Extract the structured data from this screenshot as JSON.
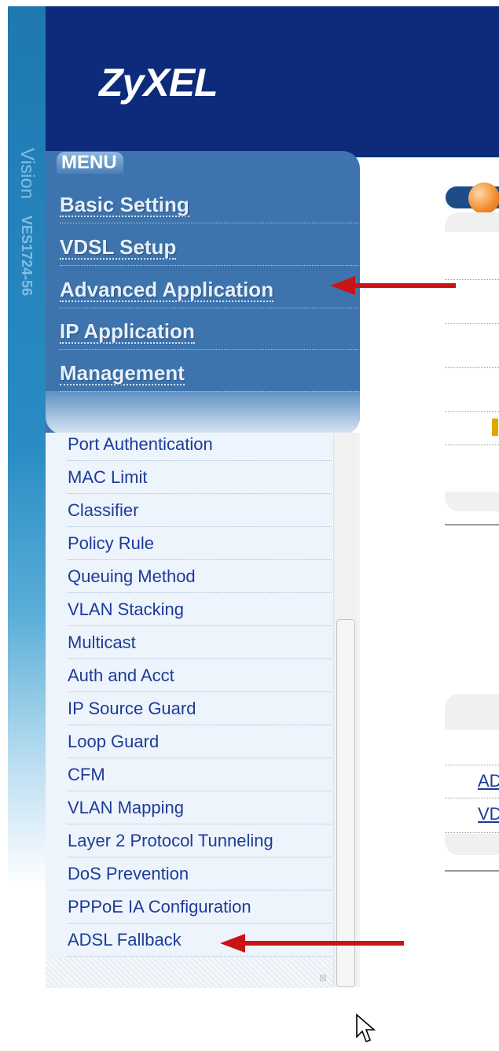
{
  "brand": {
    "strip_text": "Vision",
    "model": "VES1724-56",
    "logo": "ZyXEL"
  },
  "menu": {
    "title": "MENU",
    "items": [
      {
        "label": "Basic Setting"
      },
      {
        "label": "VDSL Setup"
      },
      {
        "label": "Advanced Application"
      },
      {
        "label": "IP Application"
      },
      {
        "label": "Management"
      }
    ]
  },
  "submenu": {
    "items": [
      {
        "label": "Port Authentication"
      },
      {
        "label": "MAC Limit"
      },
      {
        "label": "Classifier"
      },
      {
        "label": "Policy Rule"
      },
      {
        "label": "Queuing Method"
      },
      {
        "label": "VLAN Stacking"
      },
      {
        "label": "Multicast"
      },
      {
        "label": "Auth and Acct"
      },
      {
        "label": "IP Source Guard"
      },
      {
        "label": "Loop Guard"
      },
      {
        "label": "CFM"
      },
      {
        "label": "VLAN Mapping"
      },
      {
        "label": "Layer 2 Protocol Tunneling"
      },
      {
        "label": "DoS Prevention"
      },
      {
        "label": "PPPoE IA Configuration"
      },
      {
        "label": "ADSL Fallback"
      }
    ]
  },
  "content": {
    "links": [
      {
        "label": "AD"
      },
      {
        "label": "VD"
      }
    ]
  },
  "colors": {
    "header": "#0d2b7a",
    "menu": "#3d74ad",
    "submenu_link": "#1c3b99",
    "arrow": "#c81414",
    "toggle_knob": "#f08a28"
  },
  "icons": {
    "cursor": "mouse-pointer-icon",
    "resize": "resize-grip-icon",
    "arrow": "red-arrow-icon"
  }
}
